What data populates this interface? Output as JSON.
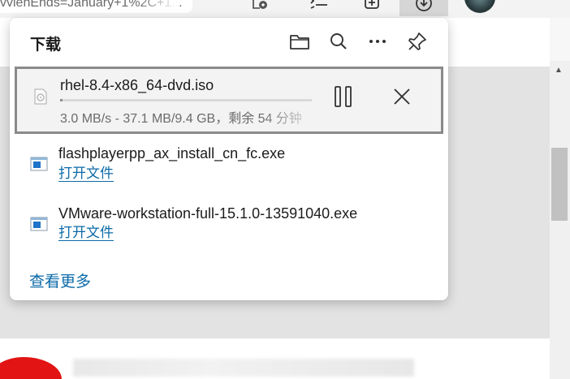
{
  "browser": {
    "url_fragment": "vviehEnds=January+1%2C+1...",
    "toolbar": {
      "favorites_icon": "favorites-list-icon",
      "collections_icon": "collections-icon",
      "downloads_icon": "download-icon",
      "profile_icon": "avatar"
    }
  },
  "panel": {
    "title": "下载",
    "header_icons": [
      "folder-icon",
      "search-icon",
      "more-icon",
      "pin-icon"
    ],
    "active_download": {
      "filename": "rhel-8.4-x86_64-dvd.iso",
      "status": "3.0 MB/s - 37.1 MB/9.4 GB，剩余 54 分钟",
      "progress_fraction": 0.004
    },
    "items": [
      {
        "filename": "flashplayerpp_ax_install_cn_fc.exe",
        "action": "打开文件"
      },
      {
        "filename": "VMware-workstation-full-15.1.0-13591040.exe",
        "action": "打开文件"
      }
    ],
    "see_more": "查看更多"
  },
  "colors": {
    "link": "#0b6aa8",
    "active_border": "#8a8a8a"
  }
}
